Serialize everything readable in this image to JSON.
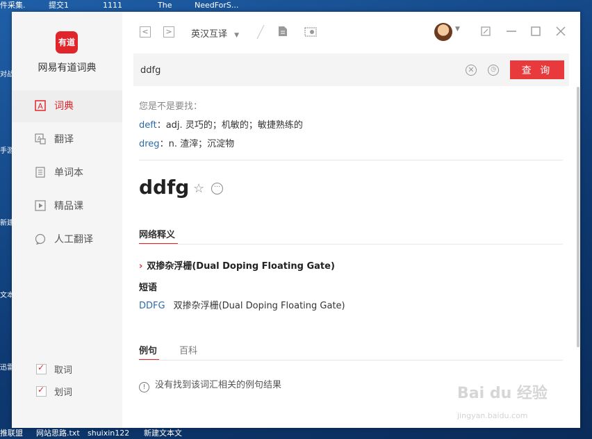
{
  "desktop": {
    "top_items": [
      "件采集.",
      "提交1",
      "1111",
      "The",
      "NeedForS..."
    ],
    "bottom_items": [
      "推联盟",
      "网站思路.txt",
      "shuixin122",
      "新建文本文"
    ],
    "left_icons": [
      "对战",
      "手游",
      "新建",
      "文本",
      "迅雷"
    ]
  },
  "sidebar": {
    "logo_text": "有道",
    "brand": "网易有道词典",
    "items": [
      {
        "label": "词典",
        "icon": "dictionary-icon"
      },
      {
        "label": "翻译",
        "icon": "translate-icon"
      },
      {
        "label": "单词本",
        "icon": "wordbook-icon"
      },
      {
        "label": "精品课",
        "icon": "course-icon"
      },
      {
        "label": "人工翻译",
        "icon": "human-translate-icon"
      }
    ],
    "options": [
      {
        "label": "取词"
      },
      {
        "label": "划词"
      }
    ]
  },
  "toolbar": {
    "mode": "英汉互译",
    "back": "<",
    "forward": ">"
  },
  "search": {
    "value": "ddfg",
    "query_label": "查 询"
  },
  "results": {
    "hint": "您是不是要找：",
    "suggestions": [
      {
        "word": "deft",
        "sep": "：",
        "def": "adj. 灵巧的；机敏的；敏捷熟练的"
      },
      {
        "word": "dreg",
        "sep": "：",
        "def": "n. 渣滓；沉淀物"
      }
    ],
    "headword": "ddfg",
    "tabs_top": [
      "网络释义"
    ],
    "definition": "双掺杂浮栅(Dual Doping Floating Gate)",
    "phrase_label": "短语",
    "phrase_word": "DDFG",
    "phrase_def": "双掺杂浮栅(Dual Doping Floating Gate)",
    "tabs_bottom": [
      "例句",
      "百科"
    ],
    "no_result": "没有找到该词汇相关的例句结果"
  },
  "watermark": {
    "main": "Bai du 经验",
    "sub": "jingyan.baidu.com"
  },
  "colors": {
    "accent": "#e0262b",
    "link": "#2d6aa8"
  }
}
